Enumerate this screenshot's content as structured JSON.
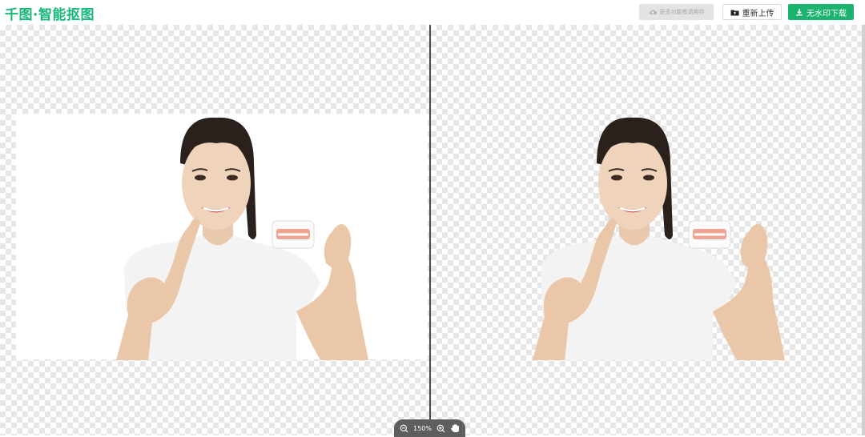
{
  "app": {
    "logo_text": "千图·智能抠图"
  },
  "toolbar": {
    "more_features_label": "更多功能敬请期待",
    "reupload_label": "重新上传",
    "download_label": "无水印下载"
  },
  "zoom": {
    "level": "150%"
  },
  "colors": {
    "brand_green": "#17b978",
    "download_green": "#1bb36d",
    "divider": "#4a4a4a"
  },
  "icons": [
    "upload-cloud-icon",
    "folder-upload-icon",
    "download-icon",
    "zoom-out-icon",
    "zoom-in-icon",
    "hand-pan-icon"
  ]
}
